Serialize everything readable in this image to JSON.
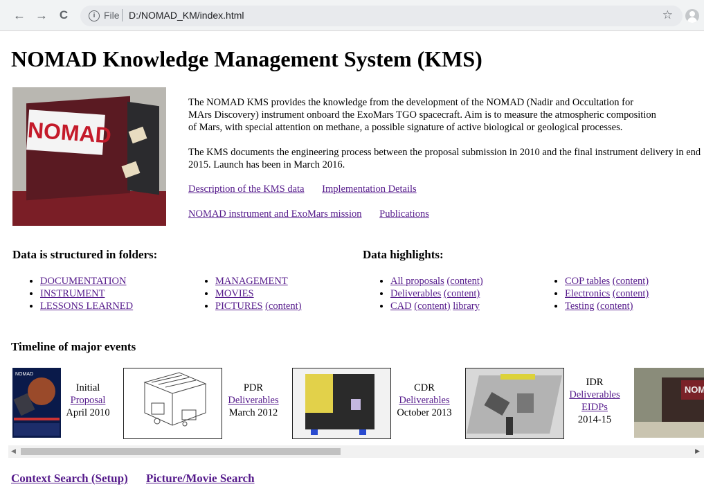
{
  "browser": {
    "back_glyph": "←",
    "forward_glyph": "→",
    "reload_glyph": "C",
    "omnibox_scheme": "File",
    "omnibox_url": "D:/NOMAD_KM/index.html"
  },
  "page": {
    "title": "NOMAD Knowledge Management System (KMS)",
    "hero_photo_text": "NOMAD",
    "intro_p1_line1": "The NOMAD KMS provides the knowledge from the development of the NOMAD (Nadir and Occultation for",
    "intro_p1_line2": "MArs Discovery) instrument onboard the ExoMars TGO spacecraft. Aim is to measure the atmospheric composition",
    "intro_p1_line3": "of Mars, with special attention on methane, a possible signature of active biological or geological processes.",
    "intro_p2": "The KMS documents the engineering process between the proposal submission in 2010 and the final instrument delivery in end 2015. Launch has been in March 2016.",
    "links_row1": [
      "Description of the KMS data",
      "Implementation Details"
    ],
    "links_row2": [
      "NOMAD instrument and ExoMars mission",
      "Publications"
    ],
    "folders_heading": "Data is structured in folders:",
    "folders_col1": [
      "DOCUMENTATION",
      "INSTRUMENT",
      "LESSONS LEARNED"
    ],
    "folders_col2": [
      "MANAGEMENT",
      "MOVIES",
      "PICTURES"
    ],
    "content_label": "(content)",
    "highlights_heading": "Data highlights:",
    "highlights_col1": [
      "All proposals",
      "Deliverables",
      "CAD"
    ],
    "cad_library": "library",
    "highlights_col2": [
      "COP tables",
      "Electronics",
      "Testing"
    ],
    "timeline_heading": "Timeline of major events",
    "timeline": [
      {
        "line1": "Initial",
        "line2": "Proposal",
        "line3": "April 2010"
      },
      {
        "line1": "PDR",
        "line2": "Deliverables",
        "line3": "March 2012"
      },
      {
        "line1": "CDR",
        "line2": "Deliverables",
        "line3": "October 2013"
      },
      {
        "line1": "IDR",
        "line2": "Deliverables",
        "line3": "EIDPs",
        "line4": "2014-15"
      }
    ],
    "poster_text": "NOMAD",
    "last_photo_text": "NOM",
    "bottom_links": [
      "Context Search (Setup)",
      "Picture/Movie Search"
    ]
  }
}
